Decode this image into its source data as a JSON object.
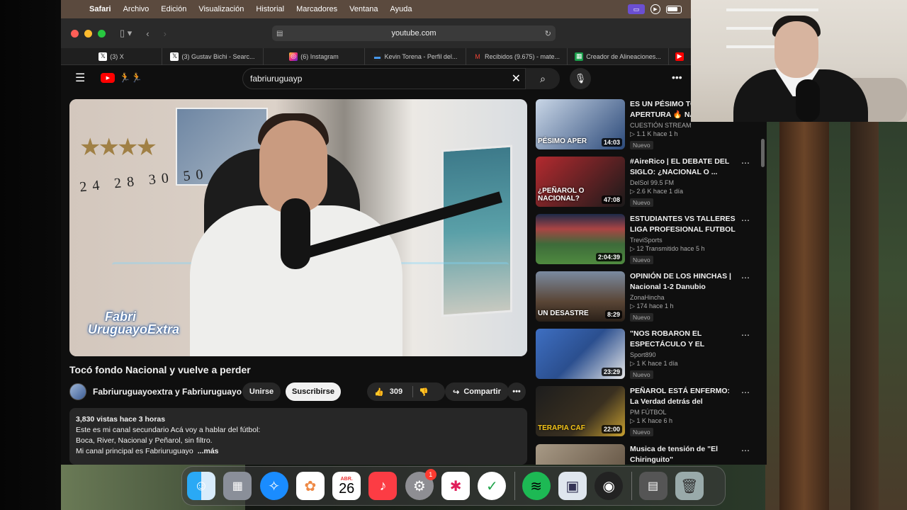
{
  "menubar": {
    "app": "Safari",
    "items": [
      "Archivo",
      "Edición",
      "Visualización",
      "Historial",
      "Marcadores",
      "Ventana",
      "Ayuda"
    ]
  },
  "browser": {
    "address": "youtube.com",
    "tabs": [
      {
        "label": "(3) X",
        "icon": "x-icon"
      },
      {
        "label": "(3) Gustav Bichi - Searc...",
        "icon": "x-icon"
      },
      {
        "label": "(6) Instagram",
        "icon": "instagram-icon"
      },
      {
        "label": "Kevin Torena - Perfil del...",
        "icon": "profile-icon"
      },
      {
        "label": "Recibidos (9.675) - mate...",
        "icon": "gmail-icon"
      },
      {
        "label": "Creador de Alineaciones...",
        "icon": "lineup-icon"
      }
    ]
  },
  "youtube": {
    "search_value": "fabriuruguayp",
    "video": {
      "logo_line1": "Fabri",
      "logo_line2": "UruguayoExtra",
      "title": "Tocó fondo Nacional y vuelve a perder",
      "channel": "Fabriuruguayoextra y Fabriuruguayo",
      "join_label": "Unirse",
      "subscribe_label": "Suscribirse",
      "likes": "309",
      "share_label": "Compartir",
      "stats": "3,830 vistas  hace 3 horas",
      "desc_lines": [
        "Este es mi canal secundario Acá voy a hablar del fútbol:",
        "Boca, River, Nacional y Peñarol, sin filtro.",
        "Mi canal principal es Fabriuruguayo"
      ],
      "more_label": "...más"
    },
    "related": [
      {
        "title": "ES UN PÉSIMO TO... APERTURA 🔥 NA...",
        "channel": "CUESTIÓN STREAM",
        "views": "▷ 1.1 K  hace 1 h",
        "badge": "Nuevo",
        "duration": "14:03",
        "caption": "PÉSIMO APER",
        "color": "#2c4a7a"
      },
      {
        "title": "#AireRico | EL DEBATE DEL SIGLO: ¿NACIONAL O ...",
        "channel": "DelSol 99.5 FM",
        "views": "▷ 2.6 K  hace 1 día",
        "badge": "Nuevo",
        "duration": "47:08",
        "caption": "¿PEÑAROL O NACIONAL?",
        "color": "#8a1f22"
      },
      {
        "title": "ESTUDIANTES VS TALLERES LIGA PROFESIONAL FUTBOL ...",
        "channel": "TreviSports",
        "views": "▷ 12  Transmitido hace 5 h",
        "badge": "Nuevo",
        "duration": "2:04:39",
        "caption": "",
        "color": "#3d6b3a"
      },
      {
        "title": "OPINIÓN DE LOS HINCHAS | Nacional 1-2 Danubio",
        "channel": "ZonaHincha",
        "views": "▷ 174  hace 1 h",
        "badge": "Nuevo",
        "duration": "8:29",
        "caption": "UN DESASTRE",
        "color": "#5a4636"
      },
      {
        "title": "\"NOS ROBARON EL ESPECTÁCULO Y EL ESTADO ...",
        "channel": "Sport890",
        "views": "▷ 1 K  hace 1 día",
        "badge": "Nuevo",
        "duration": "23:29",
        "caption": "",
        "color": "#2b4f8f"
      },
      {
        "title": "PEÑAROL ESTÁ ENFERMO: La Verdad detrás del Comunicad...",
        "channel": "PM FÚTBOL",
        "views": "▷ 1 K  hace 6 h",
        "badge": "Nuevo",
        "duration": "22:00",
        "caption": "TERAPIA CAF",
        "color": "#1d1d1d"
      },
      {
        "title": "Musica de tensión de \"El Chiringuito\"",
        "channel": "",
        "views": "",
        "badge": "",
        "duration": "",
        "caption": "",
        "color": "#7a6a5a"
      }
    ]
  },
  "dock": {
    "calendar_month": "ABR.",
    "calendar_day": "26",
    "settings_badge": "1",
    "apps": [
      "finder-icon",
      "launchpad-icon",
      "safari-icon",
      "photos-icon",
      "calendar-icon",
      "music-icon",
      "settings-icon",
      "slack-icon",
      "tasks-icon",
      "spotify-icon",
      "preview-icon",
      "obs-icon",
      "folder-icon",
      "trash-icon"
    ]
  }
}
